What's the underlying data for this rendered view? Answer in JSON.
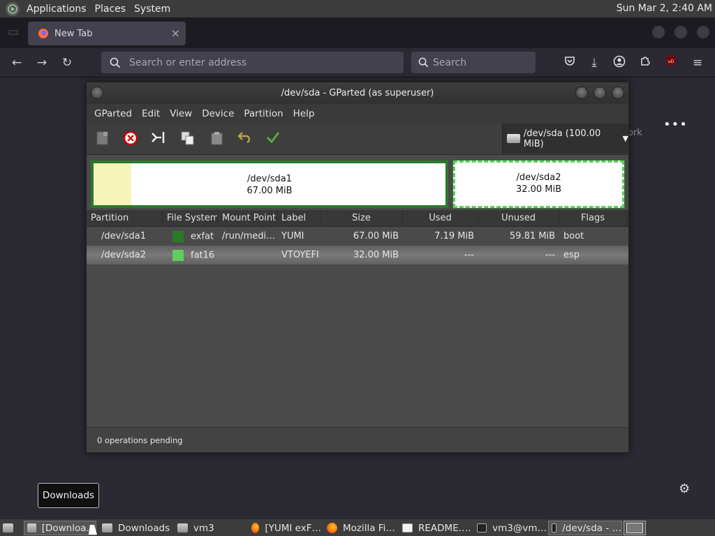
{
  "system_panel": {
    "menus": [
      "Applications",
      "Places",
      "System"
    ],
    "clock": "Sun Mar  2,  2:40 AM"
  },
  "firefox": {
    "tab": {
      "title": "New Tab",
      "close": "×"
    },
    "url_placeholder": "Search or enter address",
    "search_placeholder": "Search",
    "content_partial_text": "ork",
    "more_menu": "•••",
    "icons": [
      "back-arrow-icon",
      "forward-arrow-icon",
      "reload-icon",
      "search-icon",
      "pocket-icon",
      "download-icon",
      "account-icon",
      "extensions-icon",
      "ublock-icon",
      "hamburger-menu-icon",
      "settings-gear-icon"
    ]
  },
  "gparted": {
    "title": "/dev/sda - GParted (as superuser)",
    "menus": [
      "GParted",
      "Edit",
      "View",
      "Device",
      "Partition",
      "Help"
    ],
    "device_selector": "/dev/sda (100.00 MiB)",
    "map": [
      {
        "name": "/dev/sda1",
        "size": "67.00 MiB",
        "used_fraction": 0.107
      },
      {
        "name": "/dev/sda2",
        "size": "32.00 MiB",
        "used_fraction": 0
      }
    ],
    "columns": [
      "Partition",
      "File System",
      "Mount Point",
      "Label",
      "Size",
      "Used",
      "Unused",
      "Flags"
    ],
    "rows": [
      {
        "partition": "/dev/sda1",
        "flag_icon": "key-icon",
        "fs": "exfat",
        "fs_color": "#2b7a2b",
        "mount": "/run/medi…",
        "label": "YUMI",
        "size": "67.00 MiB",
        "used": "7.19 MiB",
        "unused": "59.81 MiB",
        "flags": "boot"
      },
      {
        "partition": "/dev/sda2",
        "flag_icon": "warning-icon",
        "fs": "fat16",
        "fs_color": "#5fcd5f",
        "mount": "",
        "label": "VTOYEFI",
        "size": "32.00 MiB",
        "used": "---",
        "unused": "---",
        "flags": "esp"
      }
    ],
    "status": "0 operations pending"
  },
  "tooltip": "Downloads",
  "taskbar": {
    "items": [
      {
        "label": "[Downloa…",
        "icon": "folder-icon",
        "active": true
      },
      {
        "label": "Downloads",
        "icon": "folder-icon",
        "active": false
      },
      {
        "label": "vm3",
        "icon": "folder-icon",
        "active": false
      },
      {
        "label": "[YUMI exF…",
        "icon": "firefox-icon",
        "active": false
      },
      {
        "label": "Mozilla Fi…",
        "icon": "firefox-icon",
        "active": false
      },
      {
        "label": "README.…",
        "icon": "text-editor-icon",
        "active": false
      },
      {
        "label": "vm3@vm…",
        "icon": "terminal-icon",
        "active": false
      },
      {
        "label": "/dev/sda - …",
        "icon": "gparted-icon",
        "active": true
      }
    ]
  }
}
